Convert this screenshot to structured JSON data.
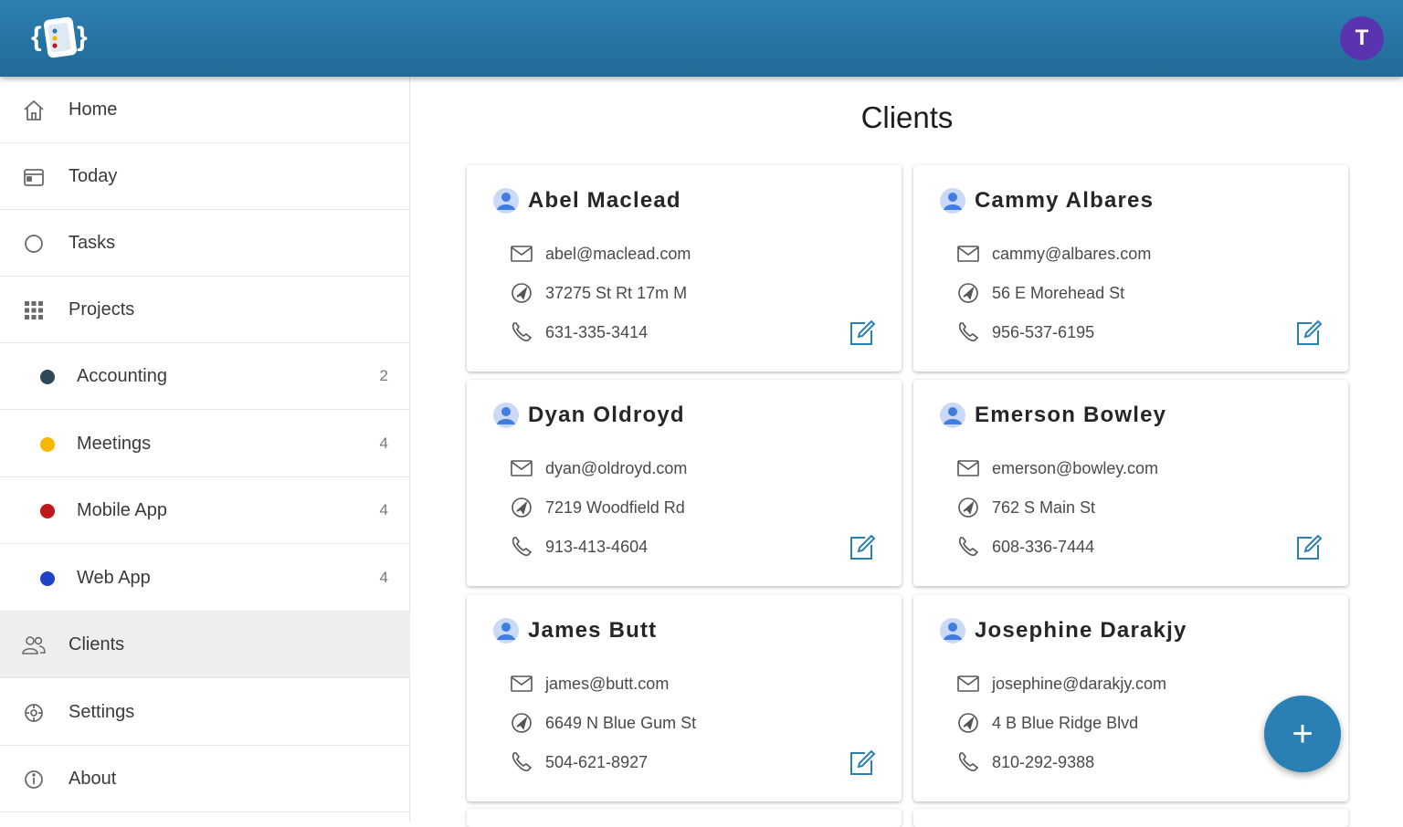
{
  "header": {
    "logo_icon": "app-logo-icon",
    "user_initial": "T",
    "avatar_color": "#5a33b0",
    "bar_color": "#2a77a8"
  },
  "sidebar": {
    "items": [
      {
        "label": "Home",
        "icon": "home-icon"
      },
      {
        "label": "Today",
        "icon": "calendar-icon"
      },
      {
        "label": "Tasks",
        "icon": "circle-icon"
      },
      {
        "label": "Projects",
        "icon": "grid-icon"
      }
    ],
    "projects": [
      {
        "label": "Accounting",
        "count": "2",
        "color": "#2f4858"
      },
      {
        "label": "Meetings",
        "count": "4",
        "color": "#f5b800"
      },
      {
        "label": "Mobile App",
        "count": "4",
        "color": "#c0171c"
      },
      {
        "label": "Web App",
        "count": "4",
        "color": "#2042c9"
      }
    ],
    "bottom": [
      {
        "label": "Clients",
        "icon": "users-icon",
        "active": true
      },
      {
        "label": "Settings",
        "icon": "settings-icon"
      },
      {
        "label": "About",
        "icon": "info-icon"
      }
    ]
  },
  "main": {
    "title": "Clients",
    "clients": [
      {
        "name": "Abel Maclead",
        "email": "abel@maclead.com",
        "address": "37275 St Rt 17m M",
        "phone": "631-335-3414"
      },
      {
        "name": "Cammy Albares",
        "email": "cammy@albares.com",
        "address": "56 E Morehead St",
        "phone": "956-537-6195"
      },
      {
        "name": "Dyan Oldroyd",
        "email": "dyan@oldroyd.com",
        "address": "7219 Woodfield Rd",
        "phone": "913-413-4604"
      },
      {
        "name": "Emerson Bowley",
        "email": "emerson@bowley.com",
        "address": "762 S Main St",
        "phone": "608-336-7444"
      },
      {
        "name": "James Butt",
        "email": "james@butt.com",
        "address": "6649 N Blue Gum St",
        "phone": "504-621-8927"
      },
      {
        "name": "Josephine Darakjy",
        "email": "josephine@darakjy.com",
        "address": "4 B Blue Ridge Blvd",
        "phone": "810-292-9388"
      }
    ],
    "fab_label": "+",
    "accent": "#2a7fb4"
  }
}
